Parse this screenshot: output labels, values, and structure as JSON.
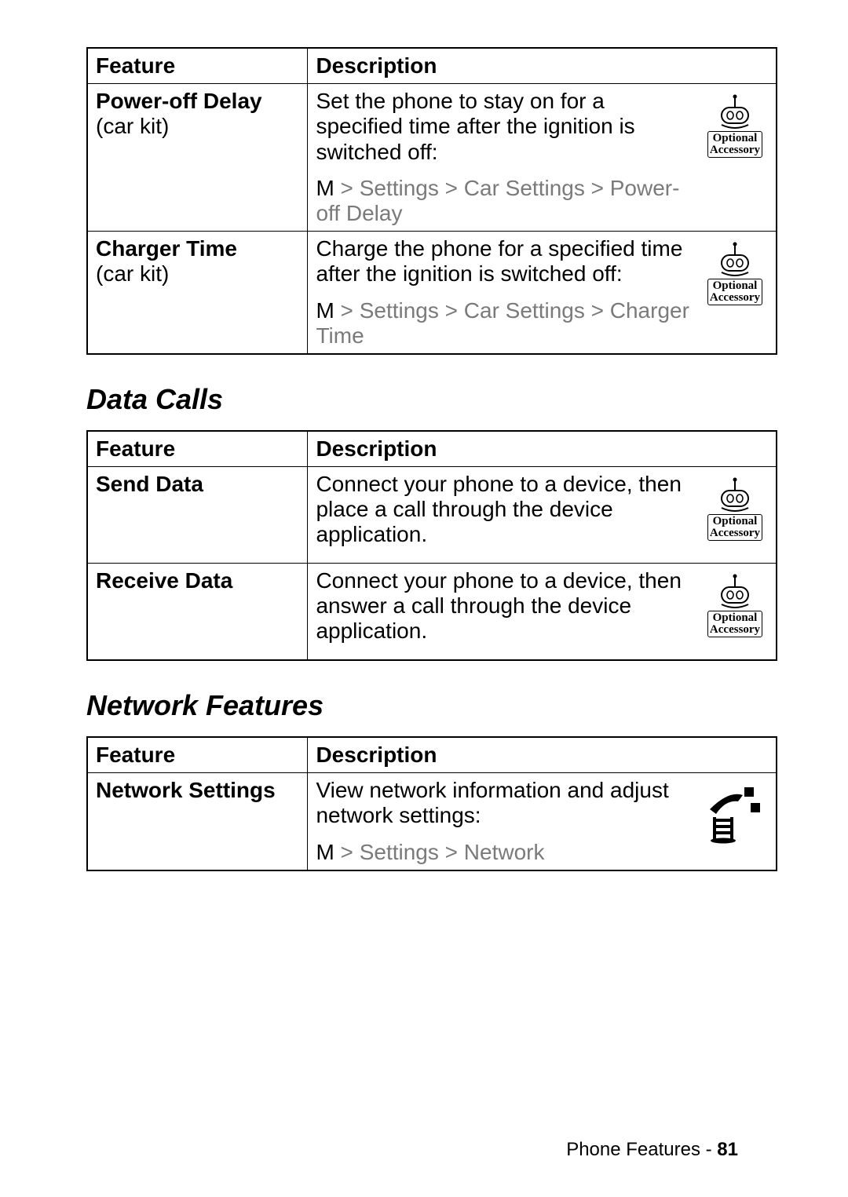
{
  "tables": {
    "car": {
      "headers": {
        "feature": "Feature",
        "description": "Description"
      },
      "rows": [
        {
          "feature_title": "Power-off Delay",
          "feature_sub": "(car kit)",
          "desc": "Set the phone to stay on for a specified time after the ignition is switched off:",
          "path_m": "M",
          "path_rest": " > Settings > Car Settings > Power-off Delay",
          "opt_label_1": "Optional",
          "opt_label_2": "Accessory",
          "has_opt_icon": true
        },
        {
          "feature_title": "Charger Time",
          "feature_sub": "(car kit)",
          "desc": "Charge the phone for a specified time after the ignition is switched off:",
          "path_m": "M",
          "path_rest": " > Settings > Car Settings > Charger Time",
          "opt_label_1": "Optional",
          "opt_label_2": "Accessory",
          "has_opt_icon": true
        }
      ]
    },
    "data_calls": {
      "heading": "Data Calls",
      "headers": {
        "feature": "Feature",
        "description": "Description"
      },
      "rows": [
        {
          "feature_title": "Send Data",
          "desc": "Connect your phone to a device, then place a call through the device application.",
          "opt_label_1": "Optional",
          "opt_label_2": "Accessory",
          "has_opt_icon": true
        },
        {
          "feature_title": "Receive Data",
          "desc": "Connect your phone to a device, then answer a call through the device application.",
          "opt_label_1": "Optional",
          "opt_label_2": "Accessory",
          "has_opt_icon": true
        }
      ]
    },
    "network": {
      "heading": "Network Features",
      "headers": {
        "feature": "Feature",
        "description": "Description"
      },
      "rows": [
        {
          "feature_title": "Network Settings",
          "desc": "View network information and adjust network settings:",
          "path_m": "M",
          "path_rest": " > Settings > Network",
          "has_net_icon": true
        }
      ]
    }
  },
  "footer": {
    "label": "Phone Features - ",
    "page": "81"
  }
}
